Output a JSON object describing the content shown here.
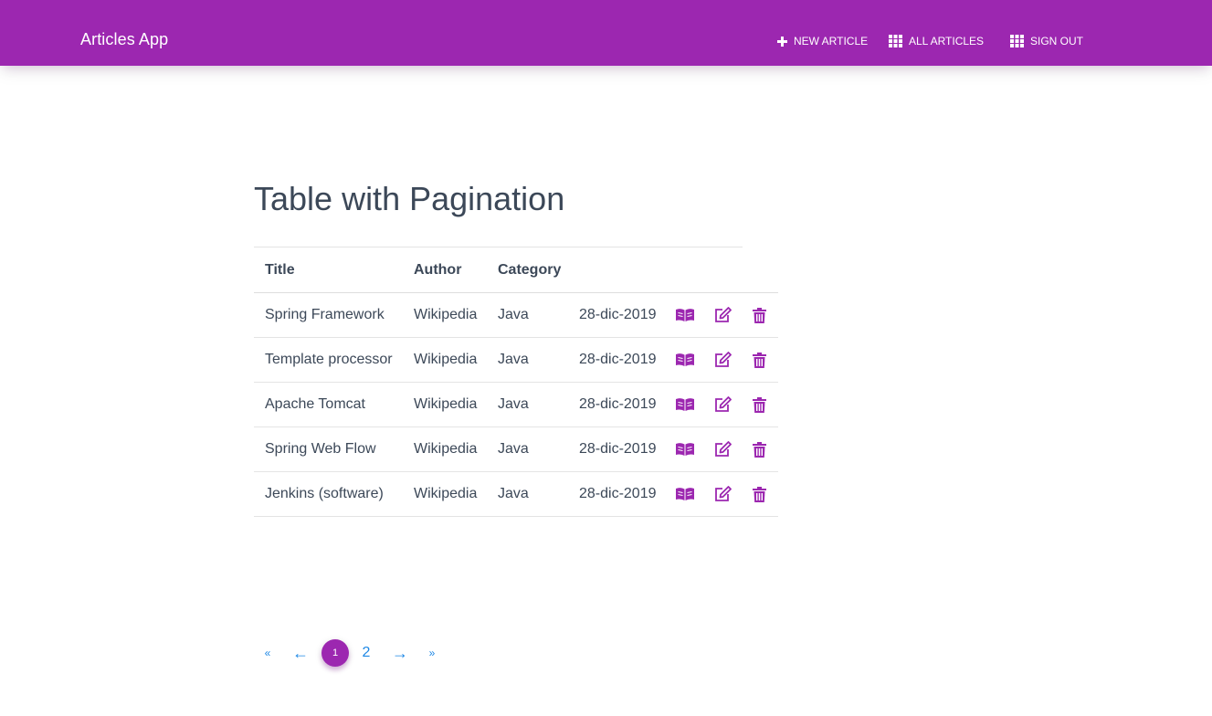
{
  "navbar": {
    "brand": "Articles App",
    "items": [
      {
        "label": "New Article",
        "icon": "plus-icon"
      },
      {
        "label": "All Articles",
        "icon": "grid-icon"
      },
      {
        "label": "Sign Out",
        "icon": "grid-icon"
      }
    ],
    "bg_color": "#9c27b0"
  },
  "page": {
    "title": "Table with Pagination"
  },
  "table": {
    "headers": [
      "Title",
      "Author",
      "Category"
    ],
    "rows": [
      {
        "title": "Spring Framework",
        "author": "Wikipedia",
        "category": "Java",
        "date": "28-dic-2019"
      },
      {
        "title": "Template processor",
        "author": "Wikipedia",
        "category": "Java",
        "date": "28-dic-2019"
      },
      {
        "title": "Apache Tomcat",
        "author": "Wikipedia",
        "category": "Java",
        "date": "28-dic-2019"
      },
      {
        "title": "Spring Web Flow",
        "author": "Wikipedia",
        "category": "Java",
        "date": "28-dic-2019"
      },
      {
        "title": "Jenkins (software)",
        "author": "Wikipedia",
        "category": "Java",
        "date": "28-dic-2019"
      }
    ],
    "action_icons": [
      "book-open-icon",
      "edit-icon",
      "trash-icon"
    ],
    "icon_color": "#9c27b0"
  },
  "pagination": {
    "first": "«",
    "prev": "←",
    "pages": [
      "1",
      "2"
    ],
    "current": "1",
    "next": "→",
    "last": "»",
    "link_color": "#1e88e5"
  }
}
